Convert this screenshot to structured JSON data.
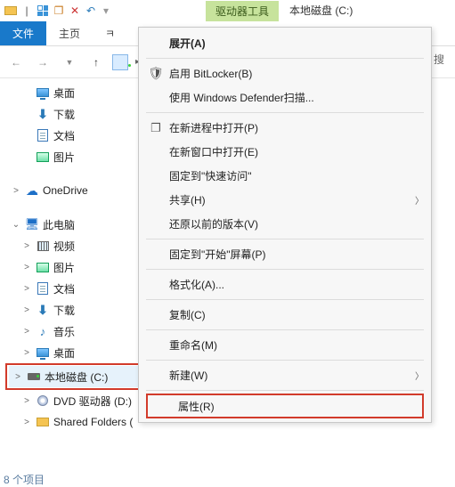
{
  "titlebar": {
    "drive_tools": "驱动器工具",
    "drive_title": "本地磁盘 (C:)"
  },
  "ribbon": {
    "file": "文件",
    "home": "主页"
  },
  "nav": {
    "search_placeholder": "搜"
  },
  "tree": {
    "quick": {
      "desktop": "桌面",
      "downloads": "下载",
      "documents": "文档",
      "pictures": "图片"
    },
    "onedrive": "OneDrive",
    "thispc": "此电脑",
    "pc": {
      "videos": "视频",
      "pictures": "图片",
      "documents": "文档",
      "downloads": "下载",
      "music": "音乐",
      "desktop": "桌面",
      "cdrive": "本地磁盘 (C:)",
      "dvd": "DVD 驱动器 (D:)",
      "shared": "Shared Folders ("
    }
  },
  "menu": {
    "expand": "展开(A)",
    "bitlocker": "启用 BitLocker(B)",
    "defender": "使用 Windows Defender扫描...",
    "newproc": "在新进程中打开(P)",
    "newwin": "在新窗口中打开(E)",
    "pinquick": "固定到\"快速访问\"",
    "share": "共享(H)",
    "restore": "还原以前的版本(V)",
    "pinstart": "固定到\"开始\"屏幕(P)",
    "format": "格式化(A)...",
    "copy": "复制(C)",
    "rename": "重命名(M)",
    "new": "新建(W)",
    "properties": "属性(R)"
  },
  "status": "8 个项目"
}
